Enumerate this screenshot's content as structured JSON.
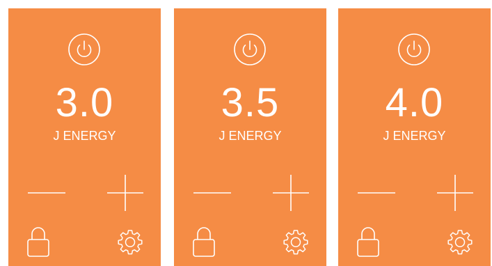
{
  "colors": {
    "panel_background": "#F58C45",
    "foreground": "#FFFFFF"
  },
  "icons": {
    "power": "power-icon",
    "minus": "minus-icon",
    "plus": "plus-icon",
    "lock": "lock-icon",
    "settings": "gear-icon"
  },
  "screens": [
    {
      "value": "3.0",
      "unit_label": "J ENERGY"
    },
    {
      "value": "3.5",
      "unit_label": "J ENERGY"
    },
    {
      "value": "4.0",
      "unit_label": "J ENERGY"
    }
  ]
}
